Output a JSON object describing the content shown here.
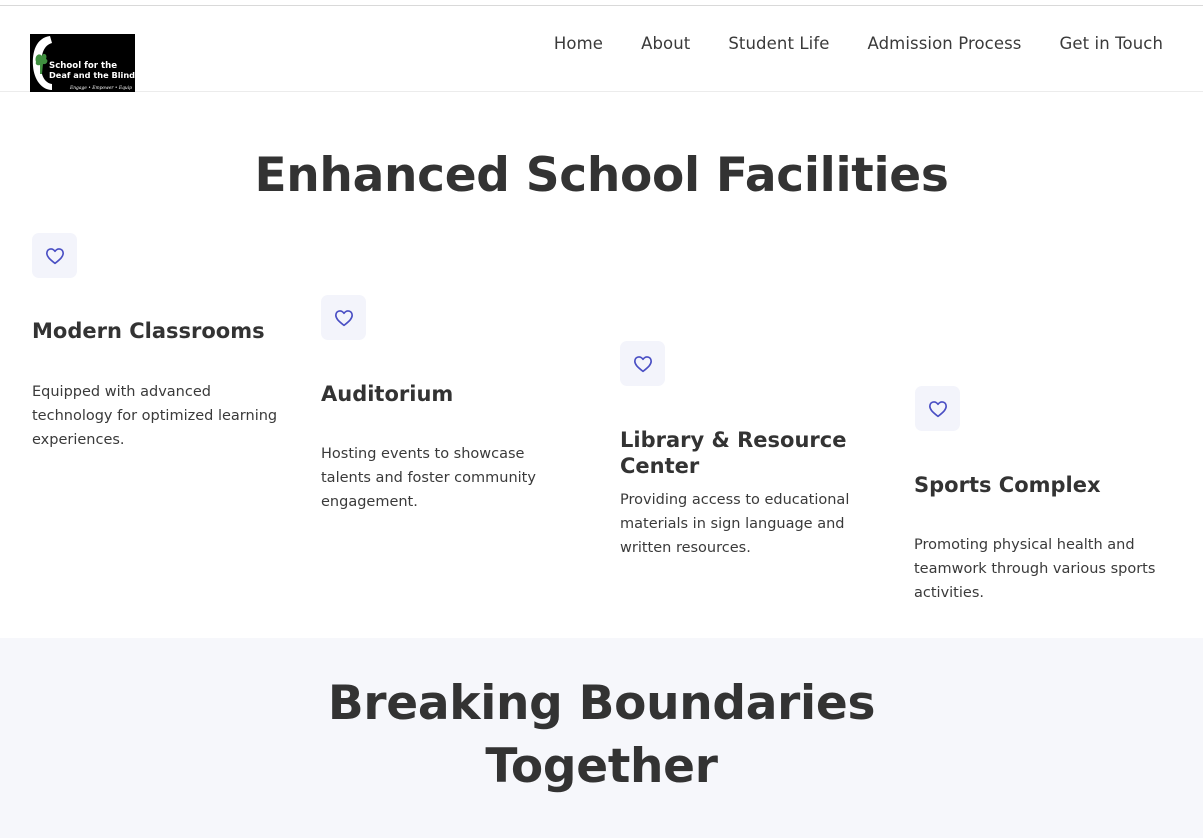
{
  "header": {
    "logo": {
      "line1": "School for the",
      "line2": "Deaf and the Blind",
      "tagline": "Engage • Empower • Equip"
    },
    "nav": [
      {
        "label": "Home"
      },
      {
        "label": "About"
      },
      {
        "label": "Student Life"
      },
      {
        "label": "Admission Process"
      },
      {
        "label": "Get in Touch"
      }
    ]
  },
  "facilities": {
    "title": "Enhanced School Facilities",
    "icon": "heart-icon",
    "accent_color": "#4a4fc4",
    "icon_bg_color": "#f3f4fb",
    "cards": [
      {
        "title": "Modern Classrooms",
        "text": "Equipped with advanced technology for optimized learning experiences."
      },
      {
        "title": "Auditorium",
        "text": "Hosting events to showcase talents and foster community engagement."
      },
      {
        "title": "Library & Resource Center",
        "text": "Providing access to educational materials in sign language and written resources."
      },
      {
        "title": "Sports Complex",
        "text": "Promoting physical health and teamwork through various sports activities."
      }
    ]
  },
  "band": {
    "title_line1": "Breaking Boundaries",
    "title_line2": "Together",
    "bg_color": "#f6f7fb"
  }
}
